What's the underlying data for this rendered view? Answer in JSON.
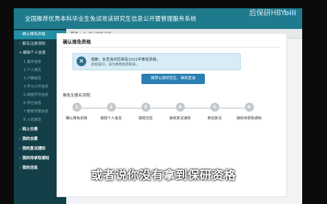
{
  "header": {
    "title": "全国推荐优秀本科毕业生免试攻读研究生信息公开暨管理服务系统"
  },
  "breadcrumb": {
    "home": "首页",
    "sep": ">",
    "current": "确认推免资格"
  },
  "sidebar": {
    "items": [
      {
        "label": "确认推免资格",
        "type": "active"
      },
      {
        "label": "报名注册须知",
        "type": "item"
      },
      {
        "label": "编辑个人信息",
        "type": "item"
      },
      {
        "label": "1.基本信息",
        "type": "sub"
      },
      {
        "label": "2.个人简历",
        "type": "sub"
      },
      {
        "label": "3.户籍信息",
        "type": "sub"
      },
      {
        "label": "4.学习工作信息",
        "type": "sub"
      },
      {
        "label": "5.家庭学历信息",
        "type": "sub"
      },
      {
        "label": "6.学位信息",
        "type": "sub"
      },
      {
        "label": "7.教育背景信息",
        "type": "sub"
      },
      {
        "label": "8.入伍信息",
        "type": "sub"
      },
      {
        "label": "网上交费",
        "type": "section"
      },
      {
        "label": "我的志愿",
        "type": "section"
      },
      {
        "label": "我的复试通知",
        "type": "section"
      },
      {
        "label": "我的待录取通知",
        "type": "section"
      },
      {
        "label": "我的消息",
        "type": "section"
      }
    ]
  },
  "main": {
    "title": "确认推免资格",
    "alert": {
      "line1": "抱歉，未查询到您具有2022年推免资格。",
      "line2": "如有疑问，请与推荐高校联系。"
    },
    "query_button": "推荐公费师范生、继续查询",
    "steps_label": "推免生报名流程：",
    "steps": [
      {
        "num": "1",
        "label": "确认推免资格"
      },
      {
        "num": "2",
        "label": "填报个人信息"
      },
      {
        "num": "3",
        "label": "填报志愿"
      },
      {
        "num": "4",
        "label": "接收复试通知"
      },
      {
        "num": "5",
        "label": "参加复试"
      },
      {
        "num": "6",
        "label": "接收待录取通知"
      }
    ]
  },
  "overlay": {
    "watermark": "后保研HBY",
    "watermark_logo": "bili",
    "subtitle": "或者说你没有拿到保研资格"
  },
  "colors": {
    "topbar": "#1e7a8c",
    "sidebar": "#123f48",
    "sidebar_active": "#1f8fa3",
    "alert_bg": "#d7ecf4",
    "button": "#2a7fb2",
    "step_circle": "#c4c9cd"
  },
  "icons": {
    "alert": "info-circle-icon",
    "nav_arrow": "chevron-right-icon"
  }
}
